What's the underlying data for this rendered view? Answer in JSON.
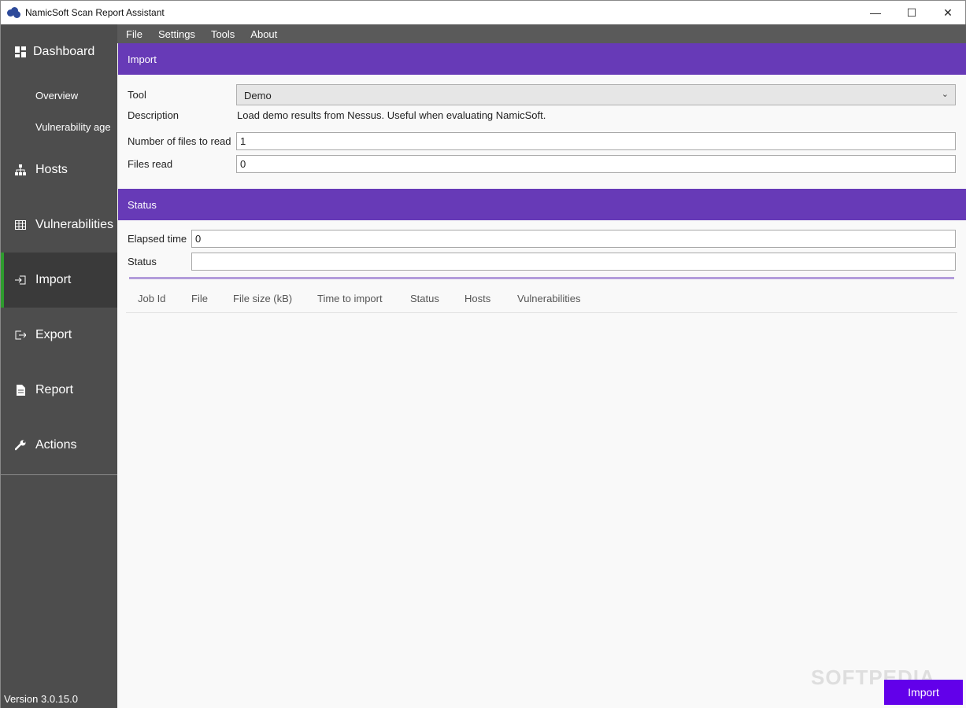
{
  "window": {
    "title": "NamicSoft Scan Report Assistant",
    "controls": {
      "minimize": "—",
      "maximize": "☐",
      "close": "✕"
    }
  },
  "sidebar": {
    "items": [
      {
        "label": "Dashboard",
        "icon": "dashboard-icon"
      },
      {
        "label": "Hosts",
        "icon": "hosts-icon"
      },
      {
        "label": "Vulnerabilities",
        "icon": "table-icon"
      },
      {
        "label": "Import",
        "icon": "import-icon",
        "active": true
      },
      {
        "label": "Export",
        "icon": "export-icon"
      },
      {
        "label": "Report",
        "icon": "document-icon"
      },
      {
        "label": "Actions",
        "icon": "wrench-icon"
      }
    ],
    "subitems": [
      {
        "label": "Overview"
      },
      {
        "label": "Vulnerability age"
      }
    ],
    "version": "Version 3.0.15.0",
    "active_accent": "#2e9c2e"
  },
  "menu": [
    "File",
    "Settings",
    "Tools",
    "About"
  ],
  "import_section": {
    "title": "Import",
    "tool_label": "Tool",
    "tool_value": "Demo",
    "description_label": "Description",
    "description_value": "Load demo results from Nessus. Useful when evaluating NamicSoft.",
    "files_to_read_label": "Number of files to read",
    "files_to_read_value": "1",
    "files_read_label": "Files read",
    "files_read_value": "0"
  },
  "status_section": {
    "title": "Status",
    "elapsed_label": "Elapsed time",
    "elapsed_value": "0",
    "status_label": "Status",
    "status_value": ""
  },
  "jobs_table": {
    "columns": [
      "Job Id",
      "File",
      "File size (kB)",
      "Time to import",
      "Status",
      "Hosts",
      "Vulnerabilities"
    ],
    "rows": []
  },
  "import_button": "Import",
  "watermark": "SOFTPEDIA",
  "colors": {
    "header": "#673ab7",
    "button": "#6200ea",
    "sidebar": "#4d4d4d",
    "progress": "#b39ddb"
  }
}
